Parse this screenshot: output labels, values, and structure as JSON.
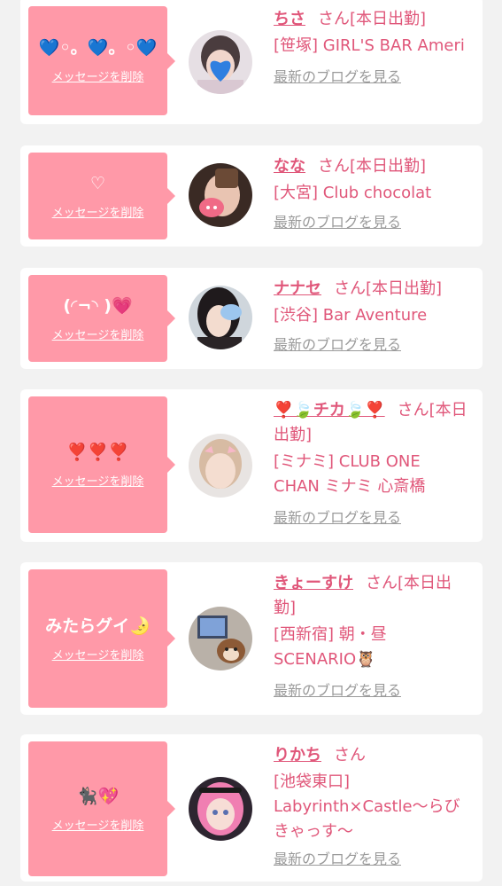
{
  "entries": [
    {
      "message": "💙◦。💙。◦💙",
      "delete_label": "メッセージを削除",
      "name": "ちさ",
      "suffix": "さん[本日出勤]",
      "shop": "[笹塚] GIRL'S BAR Ameri",
      "blog_link": "最新のブログを見る"
    },
    {
      "message": "♡",
      "delete_label": "メッセージを削除",
      "name": "なな",
      "suffix": "さん[本日出勤]",
      "shop": "[大宮] Club chocolat",
      "blog_link": "最新のブログを見る"
    },
    {
      "message": "(◜¬◝ )💗",
      "delete_label": "メッセージを削除",
      "name": "ナナセ",
      "suffix": "さん[本日出勤]",
      "shop": "[渋谷] Bar Aventure",
      "blog_link": "最新のブログを見る"
    },
    {
      "message": "❣️❣️❣️",
      "delete_label": "メッセージを削除",
      "name": "❣️🍃チカ🍃❣️",
      "suffix": "さん[本日出勤]",
      "shop": "[ミナミ] CLUB ONE CHAN ミナミ 心斎橋",
      "blog_link": "最新のブログを見る"
    },
    {
      "message": "みたらグイ🌛",
      "delete_label": "メッセージを削除",
      "name": "きょーすけ",
      "suffix": "さん[本日出勤]",
      "shop": "[西新宿] 朝・昼 SCENARIO🦉",
      "blog_link": "最新のブログを見る"
    },
    {
      "message": "🐈‍⬛💖",
      "delete_label": "メッセージを削除",
      "name": "りかち",
      "suffix": "さん",
      "shop": "[池袋東口] Labyrinth×Castle〜らびきゃっす〜",
      "blog_link": "最新のブログを見る"
    }
  ]
}
